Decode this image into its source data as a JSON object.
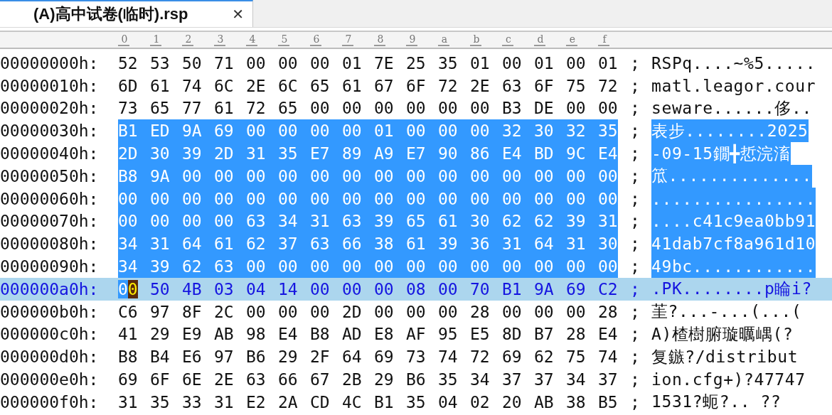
{
  "tab": {
    "title": "(A)高中试卷(临时).rsp",
    "close": "✕",
    "selected": true
  },
  "columns": [
    "0",
    "1",
    "2",
    "3",
    "4",
    "5",
    "6",
    "7",
    "8",
    "9",
    "a",
    "b",
    "c",
    "d",
    "e",
    "f"
  ],
  "rows": [
    {
      "offset": "00000000h:",
      "bytes": [
        "52",
        "53",
        "50",
        "71",
        "00",
        "00",
        "00",
        "01",
        "7E",
        "25",
        "35",
        "01",
        "00",
        "01",
        "00",
        "01"
      ],
      "sep": ";",
      "ascii": "RSPq....~%5.....",
      "selected": false,
      "current": false
    },
    {
      "offset": "00000010h:",
      "bytes": [
        "6D",
        "61",
        "74",
        "6C",
        "2E",
        "6C",
        "65",
        "61",
        "67",
        "6F",
        "72",
        "2E",
        "63",
        "6F",
        "75",
        "72"
      ],
      "sep": ";",
      "ascii": "matl.leagor.cour",
      "selected": false,
      "current": false
    },
    {
      "offset": "00000020h:",
      "bytes": [
        "73",
        "65",
        "77",
        "61",
        "72",
        "65",
        "00",
        "00",
        "00",
        "00",
        "00",
        "00",
        "B3",
        "DE",
        "00",
        "00"
      ],
      "sep": ";",
      "ascii": "seware......侈..",
      "selected": false,
      "current": false
    },
    {
      "offset": "00000030h:",
      "bytes": [
        "B1",
        "ED",
        "9A",
        "69",
        "00",
        "00",
        "00",
        "00",
        "01",
        "00",
        "00",
        "00",
        "32",
        "30",
        "32",
        "35"
      ],
      "sep": ";",
      "ascii": "表步........2025",
      "selected": true,
      "current": false
    },
    {
      "offset": "00000040h:",
      "bytes": [
        "2D",
        "30",
        "39",
        "2D",
        "31",
        "35",
        "E7",
        "89",
        "A9",
        "E7",
        "90",
        "86",
        "E4",
        "BD",
        "9C",
        "E4"
      ],
      "sep": ";",
      "ascii": "-09-15鐗╋悊浣滀",
      "selected": true,
      "current": false
    },
    {
      "offset": "00000050h:",
      "bytes": [
        "B8",
        "9A",
        "00",
        "00",
        "00",
        "00",
        "00",
        "00",
        "00",
        "00",
        "00",
        "00",
        "00",
        "00",
        "00",
        "00"
      ],
      "sep": ";",
      "ascii": "笟..............",
      "selected": true,
      "current": false
    },
    {
      "offset": "00000060h:",
      "bytes": [
        "00",
        "00",
        "00",
        "00",
        "00",
        "00",
        "00",
        "00",
        "00",
        "00",
        "00",
        "00",
        "00",
        "00",
        "00",
        "00"
      ],
      "sep": ";",
      "ascii": "................",
      "selected": true,
      "current": false
    },
    {
      "offset": "00000070h:",
      "bytes": [
        "00",
        "00",
        "00",
        "00",
        "63",
        "34",
        "31",
        "63",
        "39",
        "65",
        "61",
        "30",
        "62",
        "62",
        "39",
        "31"
      ],
      "sep": ";",
      "ascii": "....c41c9ea0bb91",
      "selected": true,
      "current": false
    },
    {
      "offset": "00000080h:",
      "bytes": [
        "34",
        "31",
        "64",
        "61",
        "62",
        "37",
        "63",
        "66",
        "38",
        "61",
        "39",
        "36",
        "31",
        "64",
        "31",
        "30"
      ],
      "sep": ";",
      "ascii": "41dab7cf8a961d10",
      "selected": true,
      "current": false
    },
    {
      "offset": "00000090h:",
      "bytes": [
        "34",
        "39",
        "62",
        "63",
        "00",
        "00",
        "00",
        "00",
        "00",
        "00",
        "00",
        "00",
        "00",
        "00",
        "00",
        "00"
      ],
      "sep": ";",
      "ascii": "49bc............",
      "selected": true,
      "current": false
    },
    {
      "offset": "000000a0h:",
      "bytes": [
        {
          "value": "00",
          "cursor": true
        },
        "50",
        "4B",
        "03",
        "04",
        "14",
        "00",
        "00",
        "00",
        "08",
        "00",
        "70",
        "B1",
        "9A",
        "69",
        "C2"
      ],
      "sep": ";",
      "ascii": ".PK........p睔i?",
      "selected": false,
      "current": true
    },
    {
      "offset": "000000b0h:",
      "bytes": [
        "C6",
        "97",
        "8F",
        "2C",
        "00",
        "00",
        "00",
        "2D",
        "00",
        "00",
        "00",
        "28",
        "00",
        "00",
        "00",
        "28"
      ],
      "sep": ";",
      "ascii": "茥?...-...(...(",
      "selected": false,
      "current": false
    },
    {
      "offset": "000000c0h:",
      "bytes": [
        "41",
        "29",
        "E9",
        "AB",
        "98",
        "E4",
        "B8",
        "AD",
        "E8",
        "AF",
        "95",
        "E5",
        "8D",
        "B7",
        "28",
        "E4"
      ],
      "sep": ";",
      "ascii": "A)楂樹腑璇曞嵎(?",
      "selected": false,
      "current": false
    },
    {
      "offset": "000000d0h:",
      "bytes": [
        "B8",
        "B4",
        "E6",
        "97",
        "B6",
        "29",
        "2F",
        "64",
        "69",
        "73",
        "74",
        "72",
        "69",
        "62",
        "75",
        "74"
      ],
      "sep": ";",
      "ascii": "复鏃?/distribut",
      "selected": false,
      "current": false
    },
    {
      "offset": "000000e0h:",
      "bytes": [
        "69",
        "6F",
        "6E",
        "2E",
        "63",
        "66",
        "67",
        "2B",
        "29",
        "B6",
        "35",
        "34",
        "37",
        "37",
        "34",
        "37"
      ],
      "sep": ";",
      "ascii": "ion.cfg+)?47747",
      "selected": false,
      "current": false
    },
    {
      "offset": "000000f0h:",
      "bytes": [
        "31",
        "35",
        "33",
        "31",
        "E2",
        "2A",
        "CD",
        "4C",
        "B1",
        "35",
        "04",
        "02",
        "20",
        "AB",
        "38",
        "B5"
      ],
      "sep": ";",
      "ascii": "1531?蚅?.. ??",
      "selected": false,
      "current": false
    }
  ]
}
